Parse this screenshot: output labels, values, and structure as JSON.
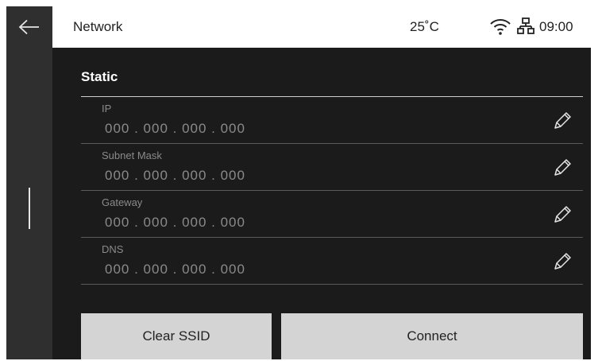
{
  "header": {
    "title": "Network",
    "temperature": "25˚C",
    "time": "09:00",
    "icons": [
      "wifi-icon",
      "lan-icon"
    ]
  },
  "rail": {
    "back_icon": "back-arrow-icon"
  },
  "section": {
    "title": "Static"
  },
  "fields": [
    {
      "label": "IP",
      "value": "000 . 000 . 000 . 000",
      "icon": "edit-pencil-icon"
    },
    {
      "label": "Subnet Mask",
      "value": "000 . 000 . 000 . 000",
      "icon": "edit-pencil-icon"
    },
    {
      "label": "Gateway",
      "value": "000 . 000 . 000 . 000",
      "icon": "edit-pencil-icon"
    },
    {
      "label": "DNS",
      "value": "000 . 000 . 000 . 000",
      "icon": "edit-pencil-icon"
    }
  ],
  "buttons": {
    "clear_ssid": "Clear SSID",
    "connect": "Connect"
  },
  "colors": {
    "background": "#1b1b1b",
    "rail": "#2f2f2f",
    "header": "#ffffff",
    "button": "#d4d4d4",
    "muted_text": "#8a8a8a"
  }
}
